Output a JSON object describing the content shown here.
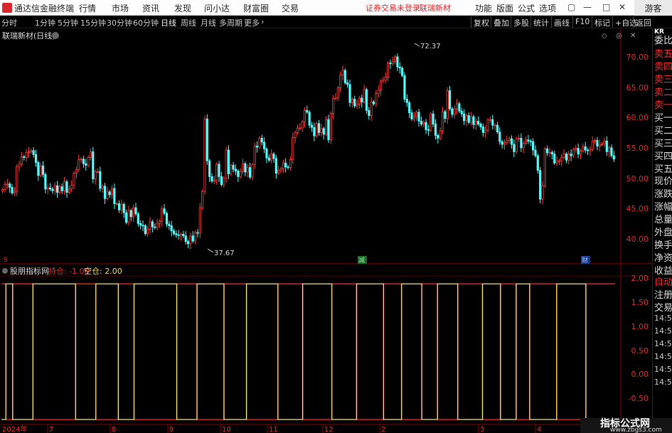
{
  "app": {
    "title": "通达信金融终端",
    "menus": [
      "行情",
      "市场",
      "资讯",
      "发现",
      "问小达",
      "财富圈",
      "交易"
    ],
    "warning": "证券交易未登录",
    "stock_tag": "联瑞新材",
    "right_menus": [
      "功能",
      "版面",
      "公式",
      "选项"
    ],
    "guest": "游客"
  },
  "toolbar": {
    "periods": [
      "分时",
      "1分钟",
      "5分钟",
      "15分钟",
      "30分钟",
      "60分钟",
      "日线",
      "周线",
      "月线",
      "多周期",
      "更多"
    ],
    "active_period": "日线",
    "right_buttons": [
      "复权",
      "叠加",
      "多股",
      "统计",
      "画线",
      "F10",
      "标记",
      "+自选",
      "返回"
    ]
  },
  "main_chart": {
    "label": "联瑞新材(日线)",
    "high_label": "72.37",
    "low_label": "37.67",
    "y_ticks": [
      "70.00",
      "65.00",
      "60.00",
      "55.00",
      "50.00",
      "45.00",
      "40.00"
    ],
    "markers": [
      "减",
      "财"
    ],
    "s_marker": "S"
  },
  "indicator": {
    "label": "股朋指标网",
    "hold": "持仓: -1.00",
    "empty": "空仓: 2.00",
    "y_ticks": [
      "2.00",
      "1.50",
      "1.00",
      "0.50",
      "0.00",
      "-0.50"
    ]
  },
  "x_axis": [
    "2024年",
    "7",
    "8",
    "9",
    "10",
    "11",
    "12",
    "2",
    "3",
    "4"
  ],
  "right_panel": {
    "header": "KR",
    "items": [
      "委比",
      "卖五",
      "卖四",
      "卖三",
      "卖二",
      "卖一",
      "买一",
      "买二",
      "买三",
      "买四",
      "买五",
      "现价",
      "涨跌",
      "涨幅",
      "总量",
      "外盘",
      "换手",
      "净资",
      "收益",
      "自动",
      "注册",
      "交易",
      "14:5",
      "14:5",
      "14:5",
      "14:5",
      "14:5",
      "14:5"
    ]
  },
  "watermark": {
    "title": "指标公式网",
    "url": "www.zbgs3.com"
  },
  "chart_data": {
    "type": "candlestick",
    "ylim": [
      36,
      74
    ],
    "high": 72.37,
    "low": 37.67,
    "colors": {
      "up": "#ff3c3c",
      "down": "#54ffff"
    },
    "closes": [
      48.5,
      49.4,
      49.5,
      48.9,
      47.9,
      48.1,
      52.6,
      53.0,
      54.3,
      54.2,
      55.1,
      55.2,
      55.4,
      54.7,
      53.3,
      51.0,
      52.7,
      51.2,
      48.6,
      48.8,
      48.6,
      48.3,
      49.2,
      48.0,
      49.0,
      48.3,
      49.9,
      48.0,
      48.6,
      49.3,
      51.4,
      52.0,
      53.8,
      53.9,
      53.1,
      52.8,
      54.2,
      55.2,
      50.4,
      51.7,
      51.7,
      48.7,
      49.1,
      46.9,
      48.1,
      47.6,
      48.7,
      46.0,
      46.0,
      44.9,
      45.9,
      44.4,
      42.7,
      44.8,
      43.7,
      45.3,
      44.2,
      42.5,
      42.2,
      42.1,
      40.7,
      41.5,
      42.8,
      41.9,
      41.8,
      42.5,
      42.9,
      45.1,
      44.3,
      42.4,
      42.1,
      41.2,
      40.7,
      40.5,
      40.4,
      40.6,
      40.3,
      39.3,
      38.9,
      40.3,
      39.4,
      40.9,
      40.8,
      45.3,
      48.2,
      61.0,
      53.6,
      50.8,
      50.0,
      50.1,
      53.0,
      50.8,
      49.4,
      50.5,
      55.5,
      51.3,
      52.8,
      52.1,
      51.8,
      50.8,
      51.7,
      53.1,
      51.6,
      52.4,
      50.7,
      52.9,
      56.2,
      56.0,
      57.6,
      56.9,
      55.7,
      54.1,
      53.7,
      54.8,
      54.0,
      51.4,
      51.9,
      52.2,
      53.2,
      52.5,
      52.4,
      53.8,
      57.7,
      58.6,
      59.4,
      59.4,
      60.5,
      62.5,
      62.2,
      59.9,
      59.5,
      58.0,
      60.2,
      58.6,
      59.3,
      58.3,
      60.9,
      57.3,
      62.0,
      64.6,
      64.7,
      66.5,
      68.8,
      69.6,
      67.4,
      67.1,
      63.9,
      64.5,
      63.3,
      63.6,
      64.7,
      64.0,
      66.2,
      62.5,
      61.6,
      64.0,
      63.7,
      65.5,
      66.1,
      67.7,
      67.9,
      68.4,
      70.9,
      70.8,
      71.2,
      72.0,
      70.2,
      70.0,
      68.7,
      64.5,
      63.9,
      62.1,
      61.0,
      61.4,
      62.2,
      60.6,
      60.1,
      60.4,
      59.1,
      59.0,
      61.9,
      60.1,
      58.1,
      57.6,
      58.9,
      62.3,
      61.1,
      66.0,
      62.8,
      61.8,
      62.8,
      63.7,
      62.4,
      61.9,
      60.7,
      61.6,
      60.4,
      61.4,
      60.0,
      60.6,
      60.1,
      59.6,
      58.6,
      59.0,
      60.8,
      60.9,
      59.9,
      59.9,
      58.7,
      57.0,
      56.5,
      56.8,
      57.2,
      57.5,
      56.5,
      55.2,
      57.5,
      57.6,
      55.9,
      56.7,
      57.3,
      57.1,
      57.0,
      55.5,
      54.5,
      51.9,
      46.8,
      49.2,
      55.7,
      55.0,
      55.1,
      54.8,
      53.2,
      53.6,
      53.6,
      54.2,
      54.8,
      53.7,
      54.8,
      54.5,
      55.6,
      55.8,
      54.8,
      55.3,
      56.1,
      55.5,
      55.4,
      55.6,
      57.1,
      57.2,
      56.2,
      56.5,
      56.6,
      57.1,
      55.2,
      55.9,
      54.5,
      53.9
    ]
  },
  "indicator_data": {
    "type": "step",
    "ylim": [
      -0.65,
      2.1
    ],
    "hold_value": -1.0,
    "empty_value": 2.0,
    "states": [
      0,
      0,
      1,
      1,
      1,
      0,
      0,
      0,
      0,
      0,
      0,
      0,
      0,
      0,
      1,
      1,
      1,
      1,
      1,
      1,
      1,
      1,
      1,
      1,
      1,
      1,
      1,
      1,
      1,
      1,
      1,
      1,
      1,
      0,
      0,
      0,
      0,
      0,
      0,
      0,
      0,
      0,
      1,
      1,
      1,
      1,
      1,
      1,
      1,
      1,
      1,
      1,
      0,
      0,
      0,
      0,
      0,
      0,
      0,
      1,
      1,
      1,
      1,
      1,
      1,
      1,
      1,
      1,
      1,
      1,
      1,
      1,
      1,
      1,
      1,
      1,
      1,
      1,
      0,
      0,
      0,
      0,
      0,
      0,
      0,
      0,
      0,
      1,
      1,
      1,
      1,
      1,
      1,
      1,
      1,
      1,
      1,
      1,
      1,
      0,
      0,
      0,
      0,
      0,
      0,
      0,
      0,
      0,
      0,
      1,
      1,
      1,
      1,
      1,
      1,
      1,
      1,
      1,
      1,
      1,
      1,
      1,
      1,
      0,
      0,
      0,
      0,
      0,
      0,
      0,
      0,
      0,
      0,
      0,
      1,
      1,
      1,
      1,
      1,
      1,
      1,
      1,
      1,
      1,
      1,
      1,
      1,
      0,
      0,
      0,
      0,
      0,
      0,
      0,
      0,
      0,
      0,
      0,
      1,
      1,
      1,
      1,
      1,
      1,
      1,
      1,
      1,
      1,
      1,
      1,
      0,
      0,
      0,
      0,
      0,
      0,
      0,
      0,
      1,
      1,
      1,
      1,
      1,
      1,
      1,
      1,
      1,
      0,
      0,
      0,
      0,
      0,
      0,
      0,
      1,
      1,
      1,
      1,
      1,
      1,
      1,
      1,
      1,
      0,
      0,
      0,
      0,
      0,
      0,
      0,
      0,
      0,
      0,
      0,
      1,
      1,
      1,
      1,
      1,
      1,
      1,
      1,
      0,
      0,
      0,
      0,
      0,
      0,
      0,
      1,
      1,
      1,
      1,
      1,
      1,
      0,
      0,
      0,
      0,
      0,
      0,
      0,
      0,
      0,
      0,
      0,
      0,
      1,
      1,
      1,
      1,
      1,
      1,
      1,
      1,
      1,
      1,
      1,
      1,
      1,
      0,
      0,
      0,
      0,
      0,
      0,
      0,
      0,
      0,
      0,
      0,
      0,
      0
    ]
  }
}
